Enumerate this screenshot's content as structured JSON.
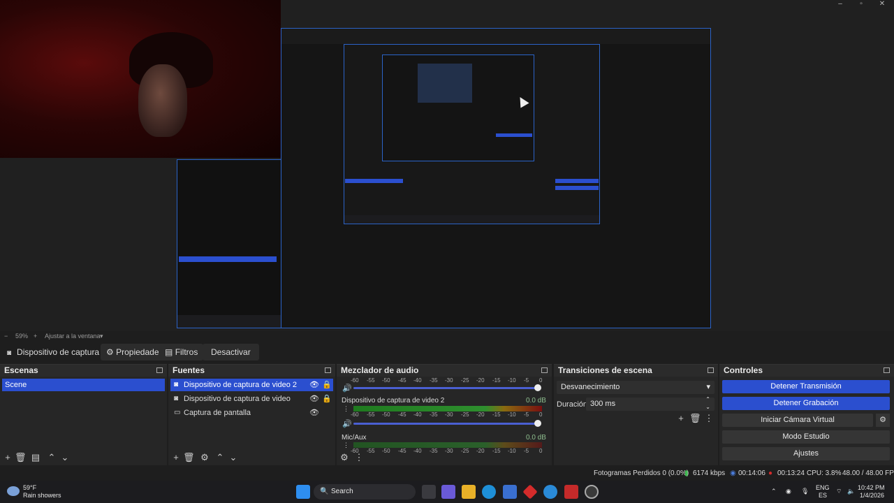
{
  "preview": {
    "zoom": "59%",
    "fit_label": "Ajustar a la ventana"
  },
  "source_toolbar": {
    "source_name": "Dispositivo de captura de v",
    "properties": "Propiedades",
    "filters": "Filtros",
    "deactivate": "Desactivar"
  },
  "scenes": {
    "title": "Escenas",
    "items": [
      "Scene"
    ]
  },
  "sources": {
    "title": "Fuentes",
    "items": [
      "Dispositivo de captura de video 2",
      "Dispositivo de captura de video",
      "Captura de pantalla"
    ]
  },
  "mixer": {
    "title": "Mezclador de audio",
    "scale": [
      "-60",
      "-55",
      "-50",
      "-45",
      "-40",
      "-35",
      "-30",
      "-25",
      "-20",
      "-15",
      "-10",
      "-5",
      "0"
    ],
    "channels": [
      {
        "name": "Dispositivo de captura de video 2",
        "db": "0.0 dB"
      },
      {
        "name": "Mic/Aux",
        "db": "0.0 dB"
      }
    ]
  },
  "transitions": {
    "title": "Transiciones de escena",
    "selected": "Desvanecimiento",
    "duration_label": "Duración",
    "duration_value": "300 ms"
  },
  "controls": {
    "title": "Controles",
    "buttons": [
      "Detener Transmisión",
      "Detener Grabación",
      "Iniciar Cámara Virtual",
      "Modo Estudio",
      "Ajustes"
    ]
  },
  "status": {
    "dropped": "Fotogramas Perdidos 0 (0.0%)",
    "bitrate": "6174 kbps",
    "stream_time": "00:14:06",
    "rec_time": "00:13:24",
    "cpu": "CPU: 3.8%",
    "fps": "48.00 / 48.00 FPS"
  },
  "taskbar": {
    "weather_temp": "59°F",
    "weather_desc": "Rain showers",
    "search": "Search",
    "lang": "ENG",
    "region": "ES",
    "time": "10:42 PM",
    "date": "1/4/2026"
  },
  "colors": {
    "accent": "#2b4fcf",
    "panel": "#262626",
    "rec": "#d42b2b"
  }
}
